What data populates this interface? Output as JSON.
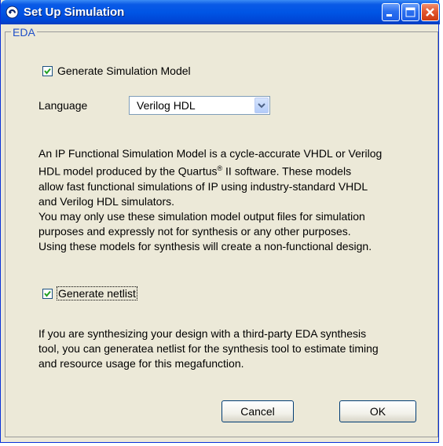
{
  "window": {
    "title": "Set Up Simulation",
    "title_bar_color": "#0055e5"
  },
  "group": {
    "label": "EDA"
  },
  "generate_model": {
    "label": "Generate Simulation Model",
    "checked": true
  },
  "language": {
    "label": "Language",
    "selected": "Verilog HDL"
  },
  "description": {
    "lines": [
      "An IP Functional Simulation Model is a cycle-accurate VHDL or Verilog",
      "HDL model produced by the Quartus",
      "II software. These models",
      "allow fast functional simulations of IP using industry-standard VHDL",
      "and Verilog HDL simulators.",
      "You may only use these simulation model output files for simulation",
      "purposes and expressly not for synthesis or any other purposes.",
      "Using these models for synthesis will create a non-functional design."
    ],
    "registered_mark": "®"
  },
  "generate_netlist": {
    "label": "Generate netlist",
    "checked": true
  },
  "netlist_info": {
    "lines": [
      "If you are synthesizing your design with a third-party EDA synthesis",
      "tool, you can generatea netlist for the synthesis tool to estimate timing",
      "and resource usage for this megafunction."
    ]
  },
  "buttons": {
    "cancel": "Cancel",
    "ok": "OK"
  },
  "icons": {
    "app": "app-icon",
    "minimize": "minimize-icon",
    "maximize": "maximize-icon",
    "close": "close-icon",
    "checkmark": "checkmark-icon",
    "dropdown": "chevron-down-icon"
  }
}
